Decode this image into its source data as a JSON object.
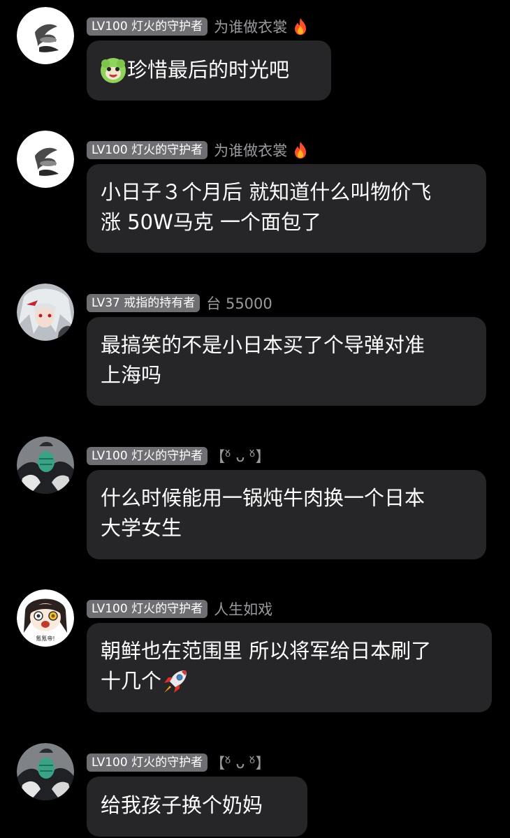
{
  "messages": [
    {
      "badge": "LV100 灯火的守护者",
      "tag": "为谁做衣裳",
      "tag_icon": "flame-icon",
      "avatar": "logo-avatar",
      "lines": [
        "珍惜最后的时光吧"
      ],
      "line_icon": "green-smiley-sticker-icon"
    },
    {
      "badge": "LV100 灯火的守护者",
      "tag": "为谁做衣裳",
      "tag_icon": "flame-icon",
      "avatar": "logo-avatar",
      "lines": [
        "小日子３个月后 就知道什么叫物价飞",
        "涨 50W马克 一个面包了"
      ]
    },
    {
      "badge": "LV37 戒指的持有者",
      "tag": "台 55000",
      "avatar": "anime-girl-avatar",
      "lines": [
        "最搞笑的不是小日本买了个导弹对准",
        "上海吗"
      ]
    },
    {
      "badge": "LV100 灯火的守护者",
      "tag": "【ᵒ̌ ᴗ ᵒ̌】",
      "avatar": "masked-person-avatar",
      "lines": [
        "什么时候能用一锅炖牛肉换一个日本",
        "大学女生"
      ]
    },
    {
      "badge": "LV100 灯火的守护者",
      "tag": "人生如戏",
      "avatar": "chibi-girl-avatar",
      "avatar_caption": "氪氪帝!",
      "lines": [
        "朝鲜也在范围里 所以将军给日本刷了",
        "十几个"
      ],
      "line_icon": "rocket-icon"
    },
    {
      "badge": "LV100 灯火的守护者",
      "tag": "【ᵒ̌ ᴗ ᵒ̌】",
      "avatar": "masked-person-avatar",
      "lines": [
        "给我孩子换个奶妈"
      ]
    }
  ],
  "colors": {
    "background": "#000000",
    "bubble": "#262628",
    "badge": "#6f6f73",
    "tag_text": "#9a9a9e",
    "message_text": "#ffffff"
  }
}
